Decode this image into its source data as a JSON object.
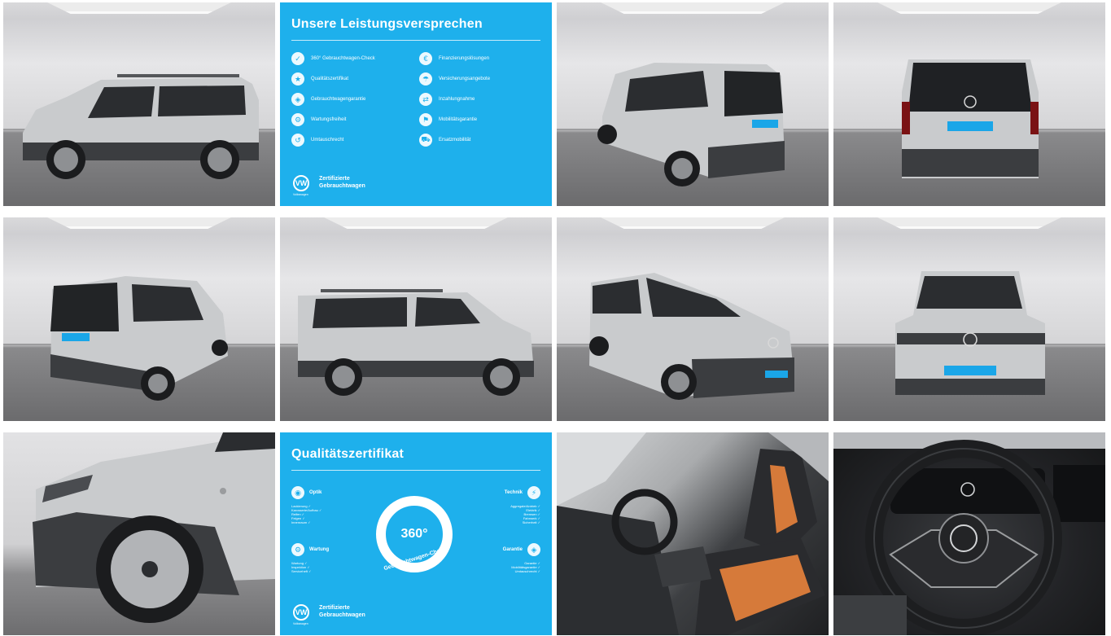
{
  "gallery": {
    "promises_panel": {
      "title": "Unsere Leistungsversprechen",
      "items": [
        {
          "label": "360° Gebrauchtwagen-Check",
          "icon": "car-check-icon"
        },
        {
          "label": "Finanzierungslösungen",
          "icon": "finance-icon"
        },
        {
          "label": "Qualitätszertifikat",
          "icon": "certificate-icon"
        },
        {
          "label": "Versicherungsangebote",
          "icon": "insurance-icon"
        },
        {
          "label": "Gebrauchtwagengarantie",
          "icon": "shield-icon"
        },
        {
          "label": "Inzahlungnahme",
          "icon": "trade-in-icon"
        },
        {
          "label": "Wartungsfreiheit",
          "icon": "wrench-icon"
        },
        {
          "label": "Mobilitätsgarantie",
          "icon": "mobility-icon"
        },
        {
          "label": "Umtauschrecht",
          "icon": "exchange-icon"
        },
        {
          "label": "Ersatzmobilität",
          "icon": "replacement-car-icon"
        }
      ],
      "footer_brand": "VW",
      "footer_sub": "Volkswagen",
      "footer_line1": "Zertifizierte",
      "footer_line2": "Gebrauchtwagen"
    },
    "quality_panel": {
      "title": "Qualitätszertifikat",
      "ring_value": "360°",
      "ring_label": "Gebrauchtwagen-Check",
      "optik": {
        "head": "Optik",
        "lines": [
          "Lackierung ✓",
          "Karosserie/Aufbau ✓",
          "Reifen ✓",
          "Felgen ✓",
          "Innenraum ✓"
        ]
      },
      "technik": {
        "head": "Technik",
        "lines": [
          "Aggregate/Antrieb ✓",
          "Elektrik ✓",
          "Bremsen ✓",
          "Fahrwerk ✓",
          "Sicherheit ✓"
        ]
      },
      "wartung": {
        "head": "Wartung",
        "lines": [
          "Wartung ✓",
          "Inspektion ✓",
          "Serviceheft ✓"
        ]
      },
      "garantie": {
        "head": "Garantie",
        "lines": [
          "Garantie ✓",
          "Mobilitätsgarantie ✓",
          "Umtauschrecht ✓"
        ]
      },
      "footer_brand": "VW",
      "footer_sub": "Volkswagen",
      "footer_line1": "Zertifizierte",
      "footer_line2": "Gebrauchtwagen"
    },
    "colors": {
      "panel_blue": "#1eb0ec",
      "car_silver": "#c9cbcd",
      "cladding": "#3b3d40",
      "seat_accent": "#d67a3a",
      "plate_blue": "#1aa6e8"
    }
  }
}
